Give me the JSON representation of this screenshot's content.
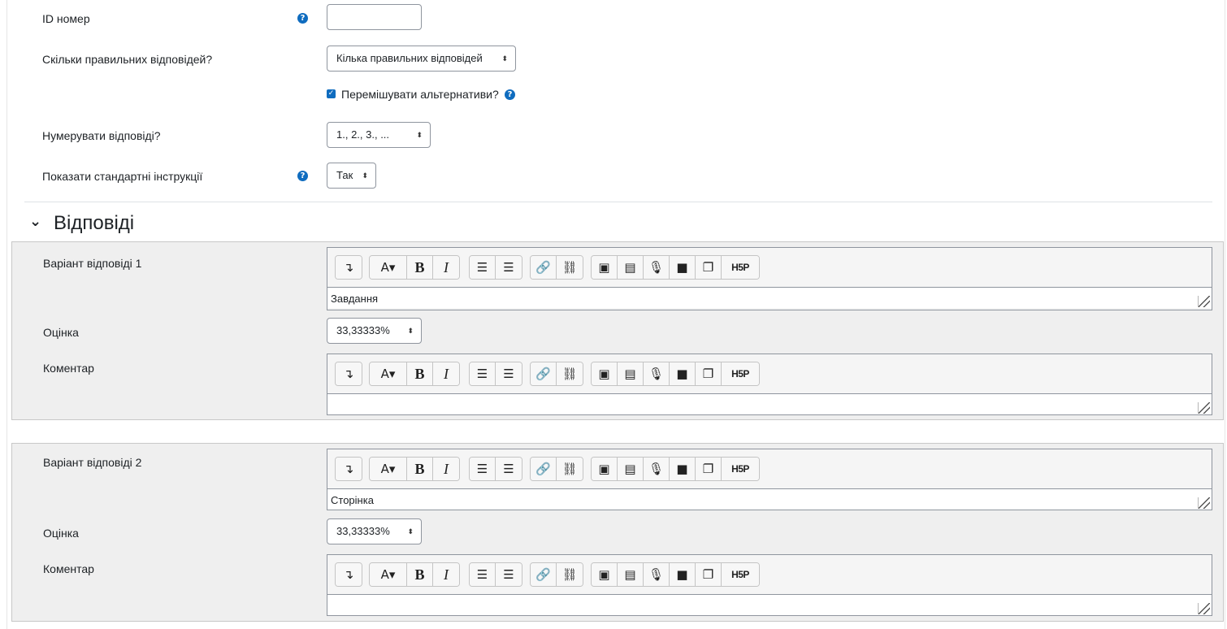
{
  "form": {
    "idnumber_label": "ID номер",
    "single_label": "Скільки правильних відповідей?",
    "single_value": "Кілька правильних відповідей",
    "shuffle_label": "Перемішувати альтернативи?",
    "shuffle_checked": true,
    "numbering_label": "Нумерувати відповіді?",
    "numbering_value": "1., 2., 3., ...",
    "instructions_label": "Показати стандартні інструкції",
    "instructions_value": "Так"
  },
  "icons": {
    "help": "?",
    "check": "✓",
    "caret": "⬍",
    "chevron": "⌄"
  },
  "section": {
    "title": "Відповіді"
  },
  "toolbar": {
    "collapse": "↴",
    "font": "A▾",
    "bold": "B",
    "italic": "I",
    "ul": "☰",
    "ol": "☰",
    "link": "🔗",
    "unlink": "⛓",
    "image": "▣",
    "media": "▤",
    "audio": "🎙",
    "video": "■",
    "manage": "❐",
    "h5p": "H5P"
  },
  "answers": [
    {
      "answer_label": "Варіант відповіді 1",
      "answer_text": "Завдання",
      "grade_label": "Оцінка",
      "grade_value": "33,33333%",
      "feedback_label": "Коментар",
      "feedback_text": ""
    },
    {
      "answer_label": "Варіант відповіді 2",
      "answer_text": "Сторінка",
      "grade_label": "Оцінка",
      "grade_value": "33,33333%",
      "feedback_label": "Коментар",
      "feedback_text": ""
    }
  ]
}
